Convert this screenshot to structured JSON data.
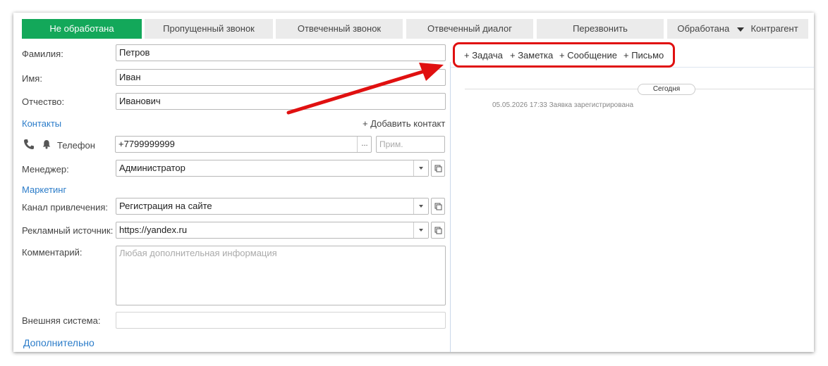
{
  "status_tabs": [
    {
      "label": "Не обработана",
      "active": true
    },
    {
      "label": "Пропущенный звонок",
      "active": false
    },
    {
      "label": "Отвеченный звонок",
      "active": false
    },
    {
      "label": "Отвеченный диалог",
      "active": false
    },
    {
      "label": "Перезвонить",
      "active": false
    },
    {
      "label": "Обработана",
      "active": false
    }
  ],
  "counterparty_label": "Контрагент",
  "form": {
    "last_name_label": "Фамилия:",
    "last_name_value": "Петров",
    "first_name_label": "Имя:",
    "first_name_value": "Иван",
    "middle_name_label": "Отчество:",
    "middle_name_value": "Иванович",
    "contacts_heading": "Контакты",
    "add_contact": "+ Добавить контакт",
    "phone_label": "Телефон",
    "phone_value": "+7799999999",
    "phone_more": "...",
    "phone_note_placeholder": "Прим.",
    "manager_label": "Менеджер:",
    "manager_value": "Администратор",
    "marketing_heading": "Маркетинг",
    "channel_label": "Канал привлечения:",
    "channel_value": "Регистрация на сайте",
    "source_label": "Рекламный источник:",
    "source_value": "https://yandex.ru",
    "comment_label": "Комментарий:",
    "comment_placeholder": "Любая дополнительная информация",
    "external_label": "Внешняя система:",
    "external_value": "",
    "more_link": "Дополнительно"
  },
  "timeline_actions": [
    "+ Задача",
    "+ Заметка",
    "+ Сообщение",
    "+ Письмо"
  ],
  "timeline": {
    "day_label": "Сегодня",
    "events": [
      "05.05.2026 17:33 Заявка зарегистрирована"
    ]
  },
  "colors": {
    "active_status": "#13a85a",
    "link": "#2b7cc9",
    "highlight": "#e01010",
    "arrow": "#e01010"
  },
  "icons": [
    "phone-icon",
    "bell-icon",
    "dropdown-arrow-icon",
    "open-form-icon",
    "caret-down-icon"
  ]
}
